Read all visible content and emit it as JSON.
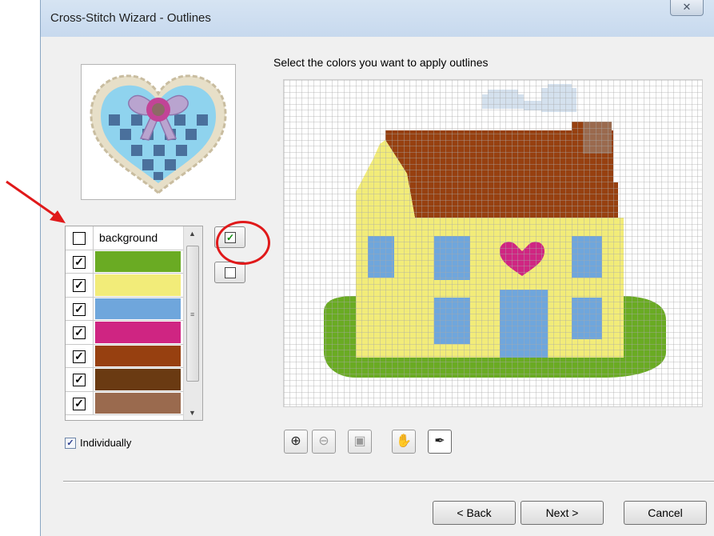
{
  "window": {
    "title": "Cross-Stitch Wizard - Outlines",
    "close_glyph": "✕"
  },
  "instruction": "Select the colors you want to apply outlines",
  "color_list": {
    "items": [
      {
        "label": "background",
        "checked": false,
        "color": null
      },
      {
        "label": "",
        "checked": true,
        "color": "#6aab23"
      },
      {
        "label": "",
        "checked": true,
        "color": "#f2ec79"
      },
      {
        "label": "",
        "checked": true,
        "color": "#6fa6dc"
      },
      {
        "label": "",
        "checked": true,
        "color": "#cf2582"
      },
      {
        "label": "",
        "checked": true,
        "color": "#974010"
      },
      {
        "label": "",
        "checked": true,
        "color": "#6a3a12"
      },
      {
        "label": "",
        "checked": true,
        "color": "#9a6a4e"
      }
    ],
    "check_glyph": "✓"
  },
  "side_buttons": {
    "check_all_icon": "checked-box-icon",
    "uncheck_all_icon": "empty-box-icon"
  },
  "individually": {
    "label": "Individually",
    "checked": true
  },
  "zoom_toolbar": [
    {
      "name": "zoom-in-icon",
      "glyph": "⊕",
      "enabled": true
    },
    {
      "name": "zoom-out-icon",
      "glyph": "⊖",
      "enabled": false
    },
    {
      "name": "zoom-fit-icon",
      "glyph": "▣",
      "enabled": false
    },
    {
      "name": "hand-pan-icon",
      "glyph": "✋",
      "enabled": false
    },
    {
      "name": "eyedropper-icon",
      "glyph": "✒",
      "enabled": true,
      "pressed": true
    }
  ],
  "buttons": {
    "back": "< Back",
    "next": "Next >",
    "cancel": "Cancel"
  },
  "design": {
    "grid_color": "#a9a9a9",
    "accent_red": "#e0191a"
  }
}
